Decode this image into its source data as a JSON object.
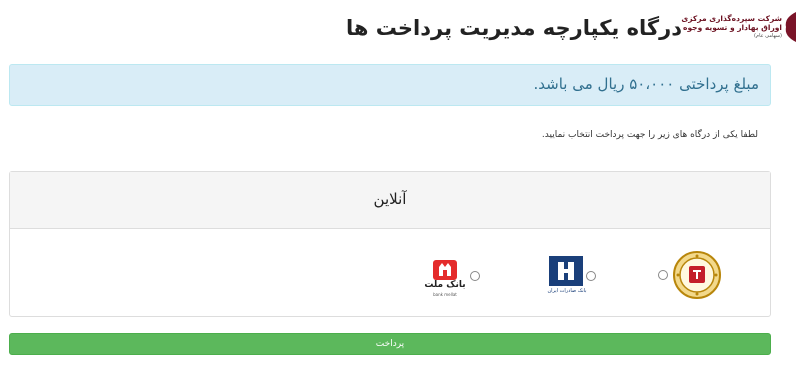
{
  "header": {
    "title": "درگاه یکپارچه مدیریت پرداخت ها",
    "logo_line1": "شرکت سپرده‌گذاری مرکزی",
    "logo_line2": "اوراق بهادار و تسویه وجوه",
    "logo_line3": "(سهامی عام)"
  },
  "alert": {
    "message": "مبلغ پرداختی ۵۰،۰۰۰ ریال می باشد."
  },
  "instruction": "لطفا یکی از درگاه های زیر را جهت پرداخت انتخاب نمایید.",
  "panel": {
    "title": "آنلاین",
    "gateways": [
      {
        "name": "bank-melli-icon"
      },
      {
        "name": "bank-saderat-icon",
        "caption": "بانک صادرات ایران"
      },
      {
        "name": "bank-mellat-icon",
        "label": "بانک ملت",
        "caption": "bank mellat"
      }
    ]
  },
  "pay_button": {
    "label": "پرداخت"
  },
  "colors": {
    "alert_bg": "#d9edf7",
    "alert_text": "#31708f",
    "button": "#5cb85c",
    "saderat": "#1a3f7a",
    "mellat": "#e42b2b",
    "melli": "#b8860b"
  }
}
